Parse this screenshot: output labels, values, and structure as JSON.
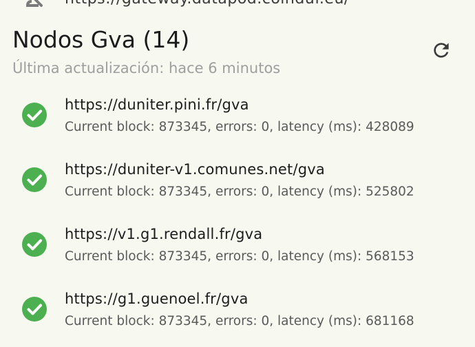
{
  "top": {
    "url": "https://gateway.datapod.coinduf.eu/",
    "icon": "cloud-off-icon"
  },
  "header": {
    "title": "Nodos Gva (14)",
    "subtitle": "Última actualización: hace 6 minutos",
    "refresh_icon": "refresh-icon"
  },
  "colors": {
    "background": "#f7f9f1",
    "check_green": "#4caf50",
    "subtitle_gray": "#9e9e9e"
  },
  "nodes": [
    {
      "url": "https://duniter.pini.fr/gva",
      "detail": "Current block: 873345, errors: 0, latency (ms): 428089",
      "status_icon": "check-circle-icon"
    },
    {
      "url": "https://duniter-v1.comunes.net/gva",
      "detail": "Current block: 873345, errors: 0, latency (ms): 525802",
      "status_icon": "check-circle-icon"
    },
    {
      "url": "https://v1.g1.rendall.fr/gva",
      "detail": "Current block: 873345, errors: 0, latency (ms): 568153",
      "status_icon": "check-circle-icon"
    },
    {
      "url": "https://g1.guenoel.fr/gva",
      "detail": "Current block: 873345, errors: 0, latency (ms): 681168",
      "status_icon": "check-circle-icon"
    }
  ]
}
